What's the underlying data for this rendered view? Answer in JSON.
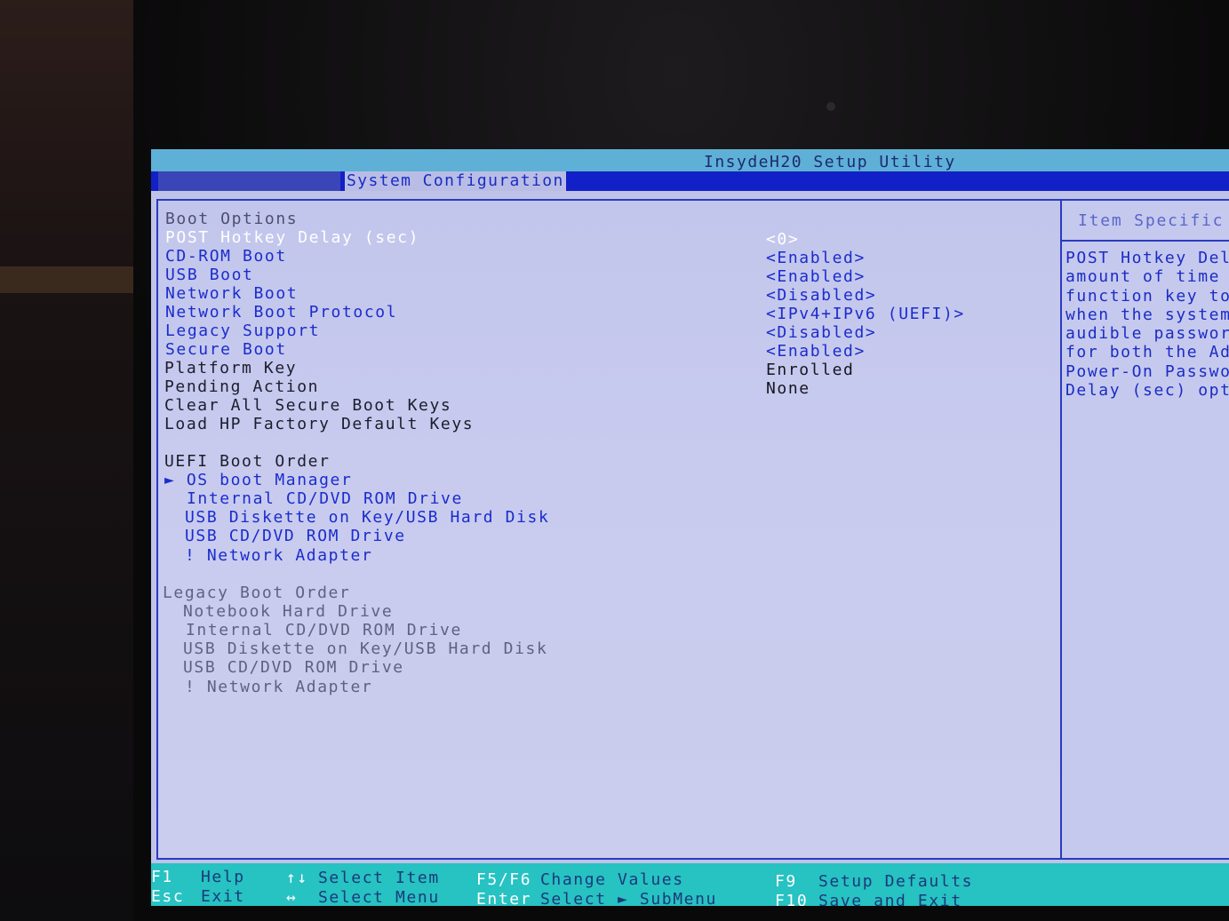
{
  "window": {
    "title": "InsydeH20 Setup Utility"
  },
  "menu": {
    "active_tab": "System Configuration"
  },
  "boot_options": {
    "header": "Boot Options",
    "items": [
      {
        "label": "POST Hotkey Delay (sec)",
        "value": "<0>"
      },
      {
        "label": "CD-ROM Boot",
        "value": "<Enabled>"
      },
      {
        "label": "USB Boot",
        "value": "<Enabled>"
      },
      {
        "label": "Network Boot",
        "value": "<Disabled>"
      },
      {
        "label": "Network Boot Protocol",
        "value": "<IPv4+IPv6 (UEFI)>"
      },
      {
        "label": "Legacy Support",
        "value": "<Disabled>"
      },
      {
        "label": "Secure Boot",
        "value": "<Enabled>"
      },
      {
        "label": "Platform Key",
        "value": "Enrolled"
      },
      {
        "label": "Pending Action",
        "value": "None"
      },
      {
        "label": "Clear All Secure Boot Keys",
        "value": ""
      },
      {
        "label": "Load HP Factory Default Keys",
        "value": ""
      }
    ]
  },
  "uefi_boot_order": {
    "header": "UEFI Boot Order",
    "items": [
      "OS boot Manager",
      "Internal CD/DVD ROM Drive",
      "USB Diskette on Key/USB Hard Disk",
      "USB CD/DVD ROM Drive",
      "! Network Adapter"
    ]
  },
  "legacy_boot_order": {
    "header": "Legacy Boot Order",
    "items": [
      "Notebook Hard Drive",
      "Internal CD/DVD ROM Drive",
      "USB Diskette on Key/USB Hard Disk",
      "USB CD/DVD ROM Drive",
      "! Network Adapter"
    ]
  },
  "help_panel": {
    "header": "Item Specific H",
    "lines": [
      "POST Hotkey Dela",
      "amount of time g",
      "function key to",
      "when the system",
      "audible passwor",
      "for both the Adm",
      "Power-On Passwor",
      "Delay (sec) opt"
    ]
  },
  "footer": {
    "f1_key": "F1",
    "f1_desc": "Help",
    "esc_key": "Esc",
    "esc_desc": "Exit",
    "select_item_arrows": "↑↓",
    "select_item_desc": "Select Item",
    "select_menu_arrows": "↔",
    "select_menu_desc": "Select Menu",
    "f5f6_key": "F5/F6",
    "f5f6_desc": "Change Values",
    "enter_key": "Enter",
    "enter_desc": "Select ► SubMenu",
    "f9_key": "F9",
    "f9_desc": "Setup Defaults",
    "f10_key": "F10",
    "f10_desc": "Save and Exit"
  },
  "colors": {
    "screen_bg": "#bfc3e8",
    "title_bar": "#5fb0d6",
    "menu_bar": "#1220c8",
    "selected_text": "#ffffff",
    "item_blue": "#1b2ccd",
    "footer_bg": "#27c2c2"
  }
}
